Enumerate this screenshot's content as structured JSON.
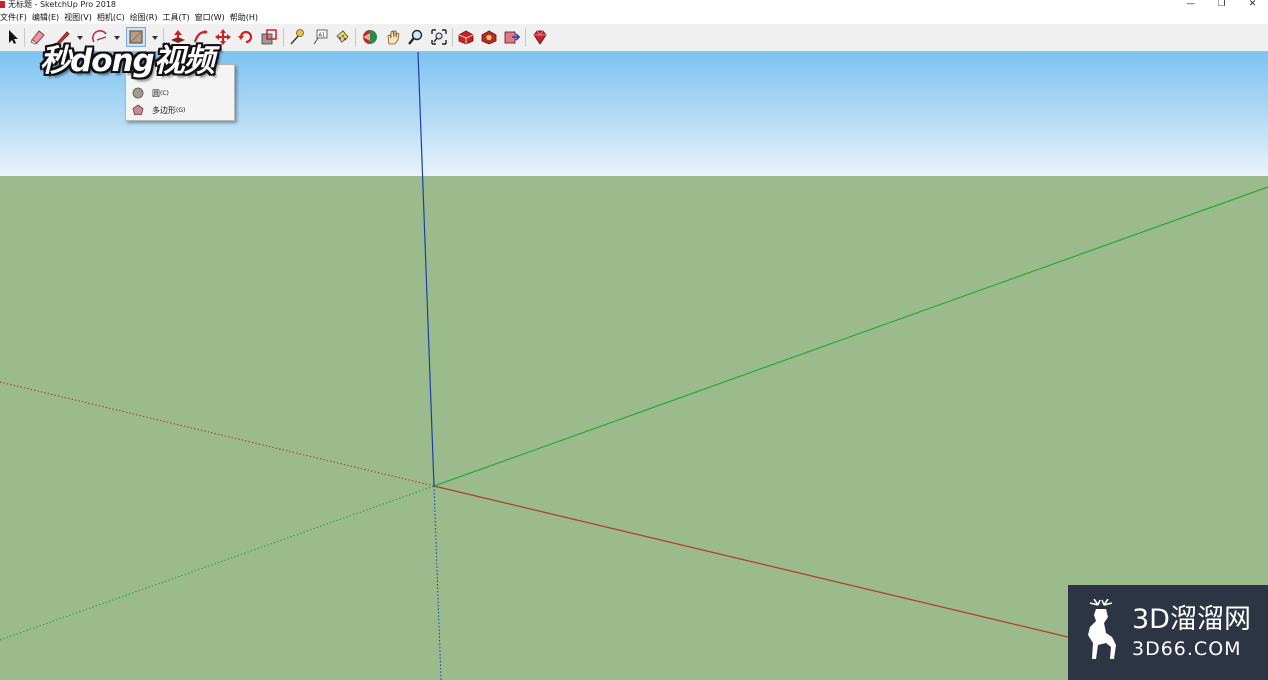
{
  "window": {
    "title": "无标题 - SketchUp Pro 2018",
    "controls": [
      "—",
      "❐",
      "✕"
    ]
  },
  "menubar": {
    "items": [
      "文件(F)",
      "编辑(E)",
      "视图(V)",
      "相机(C)",
      "绘图(R)",
      "工具(T)",
      "窗口(W)",
      "帮助(H)"
    ]
  },
  "dropdown": {
    "items": [
      {
        "label": "圆",
        "shortcut": "(C)",
        "icon": "circle-icon"
      },
      {
        "label": "多边形",
        "shortcut": "(G)",
        "icon": "polygon-icon"
      }
    ]
  },
  "overlay_logo": "秒dong视频",
  "watermark": {
    "title": "3D溜溜网",
    "subtitle": "3D66.COM"
  },
  "colors": {
    "sky_top": "#7dc3f2",
    "ground": "#9bbb8d",
    "axis_blue": "#1f3fa8",
    "axis_green": "#2aa83a",
    "axis_red": "#b0392a",
    "brand_red": "#c8202c"
  }
}
